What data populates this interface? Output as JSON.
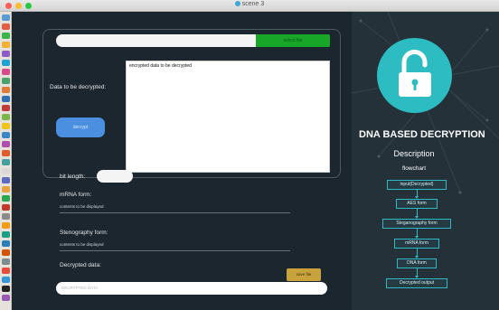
{
  "window": {
    "title": "scene 3"
  },
  "file_select": {
    "path_value": "",
    "browse_label": "select file"
  },
  "data_input": {
    "label": "Data to be decrypted:",
    "value": "encrypted data to be decrypted"
  },
  "decrypt_button": {
    "label": "decrypt"
  },
  "bit_length": {
    "label": "bit length:",
    "value": ""
  },
  "mrna_form": {
    "label": "mRNA form:",
    "value": "contents to be displayed"
  },
  "steganography_form": {
    "label": "Stenography form:",
    "value": "contents to be displayed"
  },
  "decrypted_data": {
    "label": "Decrypted data:",
    "save_label": "save file",
    "placeholder": "DECRYPTED DATA"
  },
  "right_panel": {
    "heading": "DNA BASED DECRYPTION",
    "description_heading": "Description",
    "flowchart_heading": "flowchart",
    "flowchart_steps": [
      "input(Decrypted)",
      "AES form",
      "Steganography form",
      "mRNA form",
      "DNA form",
      "Decrypted output"
    ]
  },
  "colors": {
    "accent_teal": "#2cbcc1",
    "browse_green": "#18a628",
    "decrypt_blue": "#4b8fe0",
    "save_gold": "#c9a23c"
  },
  "icons": {
    "lock": "unlocked-padlock-icon"
  }
}
